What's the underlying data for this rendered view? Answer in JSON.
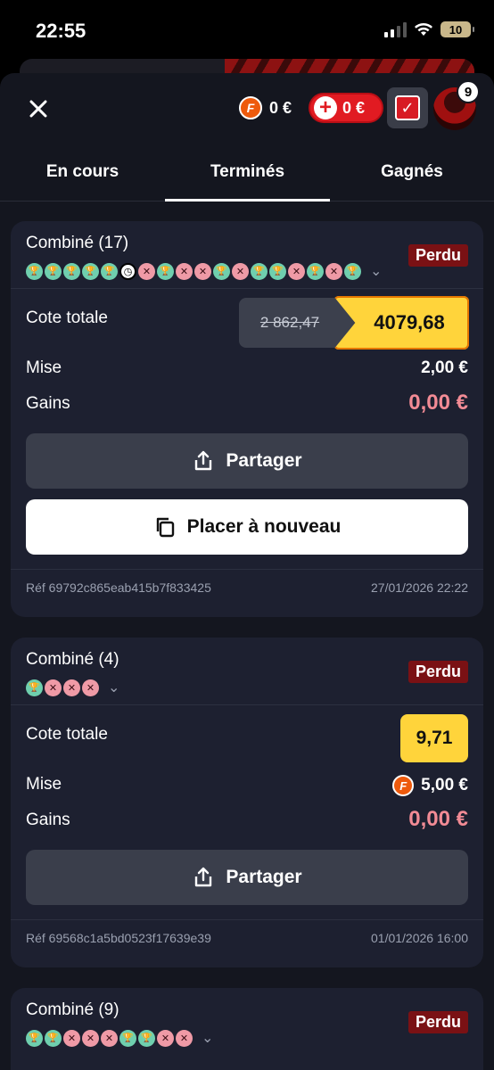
{
  "status_bar": {
    "time": "22:55",
    "battery": "10"
  },
  "header": {
    "close_icon": "×",
    "coin_balance": "0 €",
    "bonus_balance": "0 €",
    "notification_count": "9"
  },
  "tabs": [
    {
      "label": "En cours"
    },
    {
      "label": "Terminés"
    },
    {
      "label": "Gagnés"
    }
  ],
  "bets": [
    {
      "title": "Combiné (17)",
      "status": "Perdu",
      "legs": [
        "won",
        "won",
        "won",
        "won",
        "won",
        "pending",
        "lost",
        "won",
        "lost",
        "lost",
        "won",
        "lost",
        "won",
        "won",
        "lost",
        "won",
        "lost",
        "won"
      ],
      "odds_label": "Cote totale",
      "old_odds": "2 862,47",
      "odds": "4079,68",
      "stake_label": "Mise",
      "stake": "2,00 €",
      "gains_label": "Gains",
      "gains": "0,00 €",
      "share_label": "Partager",
      "replay_label": "Placer à nouveau",
      "ref": "Réf 69792c865eab415b7f833425",
      "date": "27/01/2026 22:22"
    },
    {
      "title": "Combiné (4)",
      "status": "Perdu",
      "legs": [
        "won",
        "lost",
        "lost",
        "lost"
      ],
      "odds_label": "Cote totale",
      "odds": "9,71",
      "stake_label": "Mise",
      "stake": "5,00 €",
      "gains_label": "Gains",
      "gains": "0,00 €",
      "share_label": "Partager",
      "ref": "Réf 69568c1a5bd0523f17639e39",
      "date": "01/01/2026 16:00"
    },
    {
      "title": "Combiné (9)",
      "status": "Perdu",
      "legs": [
        "won",
        "won",
        "lost",
        "lost",
        "lost",
        "won",
        "won",
        "lost",
        "lost"
      ]
    }
  ],
  "icons": {
    "trophy": "🏆",
    "cross": "✕",
    "clock": "◷"
  },
  "colors": {
    "accent_yellow": "#ffd43b",
    "lost_badge": "#7a1114",
    "won_leg": "#6fcfae",
    "lost_leg": "#ef9aa6",
    "gains_zero": "#f28b95"
  }
}
